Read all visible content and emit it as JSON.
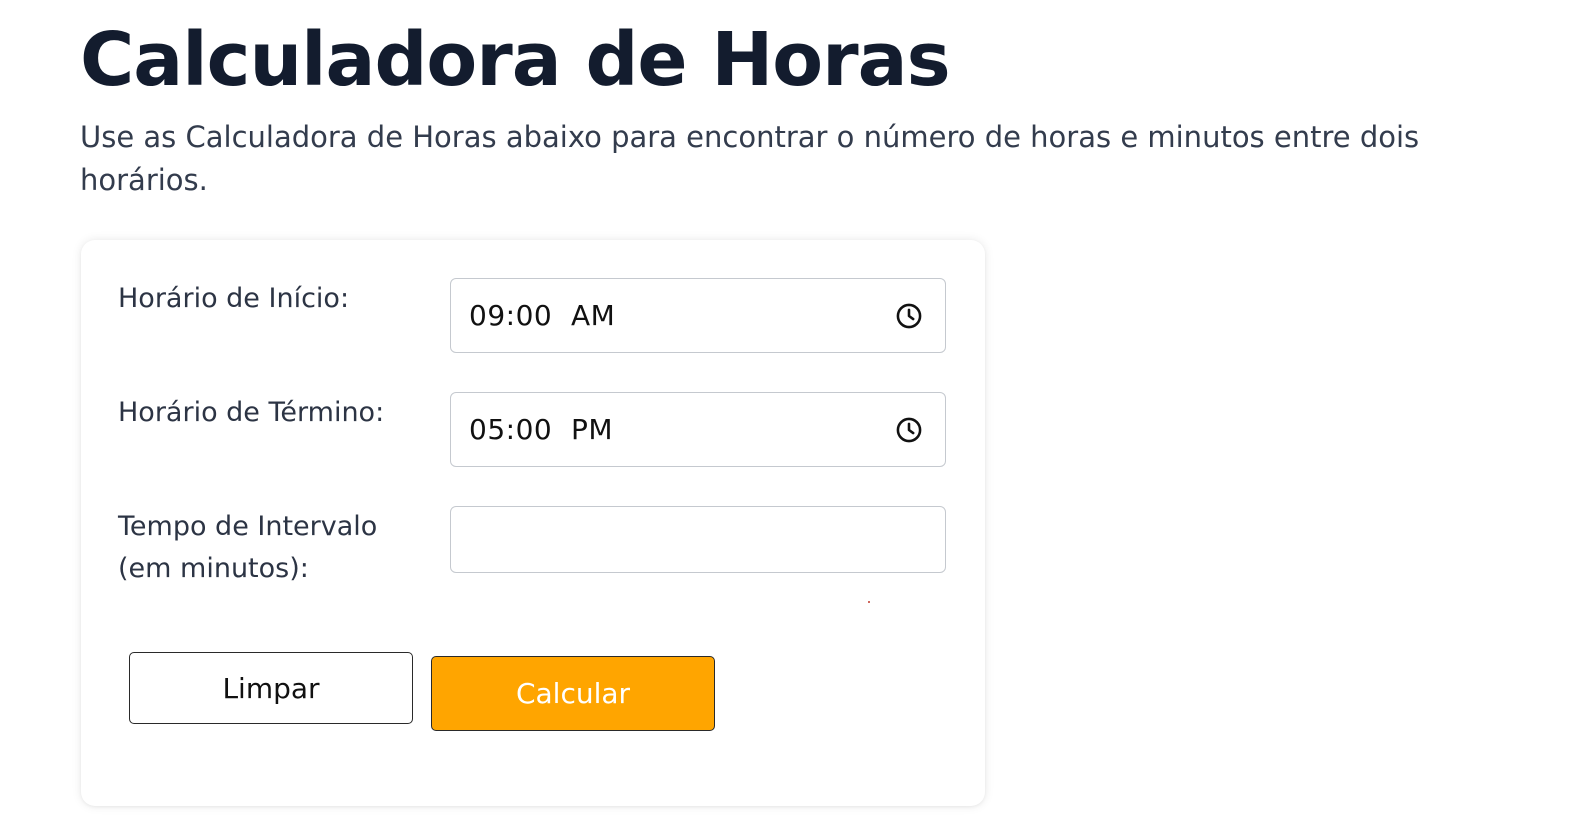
{
  "header": {
    "title": "Calculadora de Horas",
    "description": "Use as Calculadora de Horas abaixo para encontrar o número de horas e minutos entre dois horários."
  },
  "form": {
    "start_label": "Horário de Início:",
    "start_value": "09:00  AM",
    "end_label": "Horário de Término:",
    "end_value": "05:00  PM",
    "break_label_line1": "Tempo de Intervalo",
    "break_label_line2": "(em minutos):",
    "break_value": "",
    "clock_icon": "clock-icon"
  },
  "buttons": {
    "clear_label": "Limpar",
    "calculate_label": "Calcular"
  },
  "colors": {
    "accent": "#ffa500",
    "title": "#131c2e",
    "input_border": "#c5c9cf"
  }
}
